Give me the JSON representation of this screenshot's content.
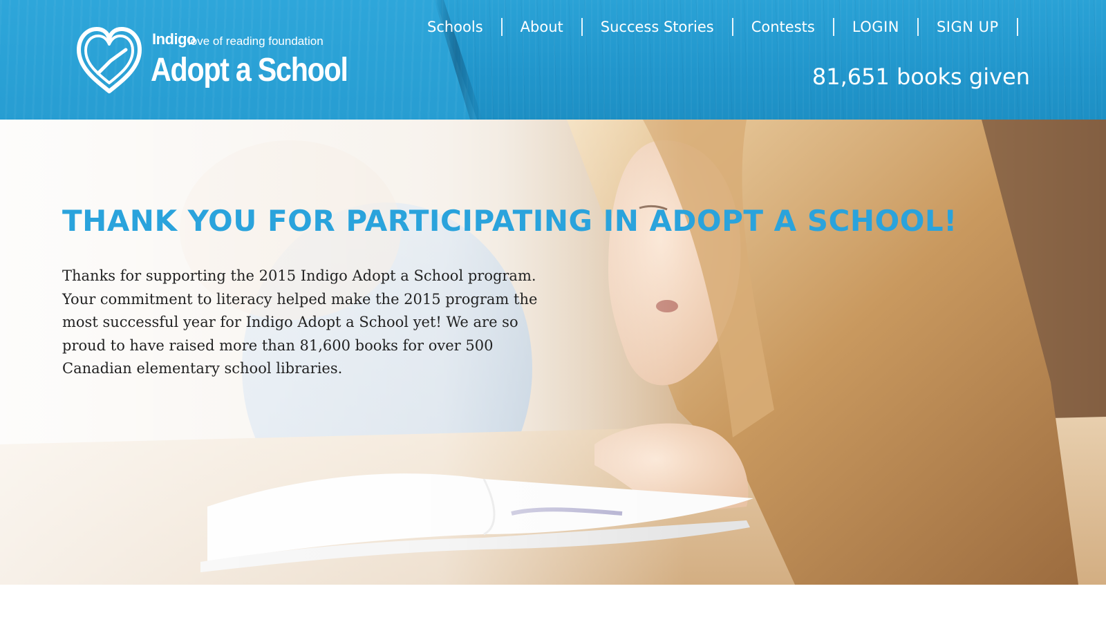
{
  "header": {
    "logo": {
      "brand": "Indigo",
      "tagline": "love of reading foundation",
      "title": "Adopt a School",
      "icon": "heart-book-icon"
    },
    "nav": [
      {
        "label": "Schools"
      },
      {
        "label": "About"
      },
      {
        "label": "Success Stories"
      },
      {
        "label": "Contests"
      },
      {
        "label": "LOGIN"
      },
      {
        "label": "SIGN UP"
      }
    ],
    "counter": "81,651 books given"
  },
  "hero": {
    "title": "THANK YOU FOR PARTICIPATING IN ADOPT A SCHOOL!",
    "body": "Thanks for supporting the 2015 Indigo Adopt a School program. Your commitment to literacy helped make the 2015 program the most successful year for Indigo Adopt a School yet! We are so proud to have raised more than 81,600 books for over 500 Canadian elementary school libraries.",
    "image": "girl-reading-book-photo"
  },
  "colors": {
    "header_blue": "#2196cc",
    "accent_blue": "#2aa3dc",
    "body_text": "#222222",
    "white": "#ffffff"
  }
}
